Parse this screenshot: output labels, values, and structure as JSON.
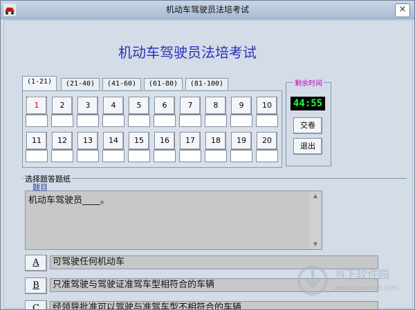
{
  "window": {
    "title": "机动车驾驶员法培考试",
    "close_glyph": "×"
  },
  "heading": "机动车驾驶员法培考试",
  "tabs": [
    "(1-21)",
    "(21-40)",
    "(41-60)",
    "(61-80)",
    "(81-100)"
  ],
  "question_numbers": [
    "1",
    "2",
    "3",
    "4",
    "5",
    "6",
    "7",
    "8",
    "9",
    "10",
    "11",
    "12",
    "13",
    "14",
    "15",
    "16",
    "17",
    "18",
    "19",
    "20"
  ],
  "current_question": "1",
  "timer": {
    "label": "剩余时间",
    "value": "44:55"
  },
  "buttons": {
    "submit": "交卷",
    "exit": "退出"
  },
  "answer_section": {
    "label": "选择题答题纸",
    "question_label": "题目",
    "question_text": "机动车驾驶员____。"
  },
  "options": [
    {
      "key": "A",
      "text": "可驾驶任何机动车"
    },
    {
      "key": "B",
      "text": "只准驾驶与驾驶证准驾车型相符合的车辆"
    },
    {
      "key": "C",
      "text": "经领导批准可以驾驶与准驾车型不相符合的车辆"
    }
  ],
  "watermark": {
    "text": "当下软件园",
    "url": "www.downxia.com"
  },
  "colors": {
    "heading": "#2a2fb8",
    "timer_digits": "#1dff3c",
    "timer_label": "#c000c0",
    "current_question": "#dd0000"
  }
}
